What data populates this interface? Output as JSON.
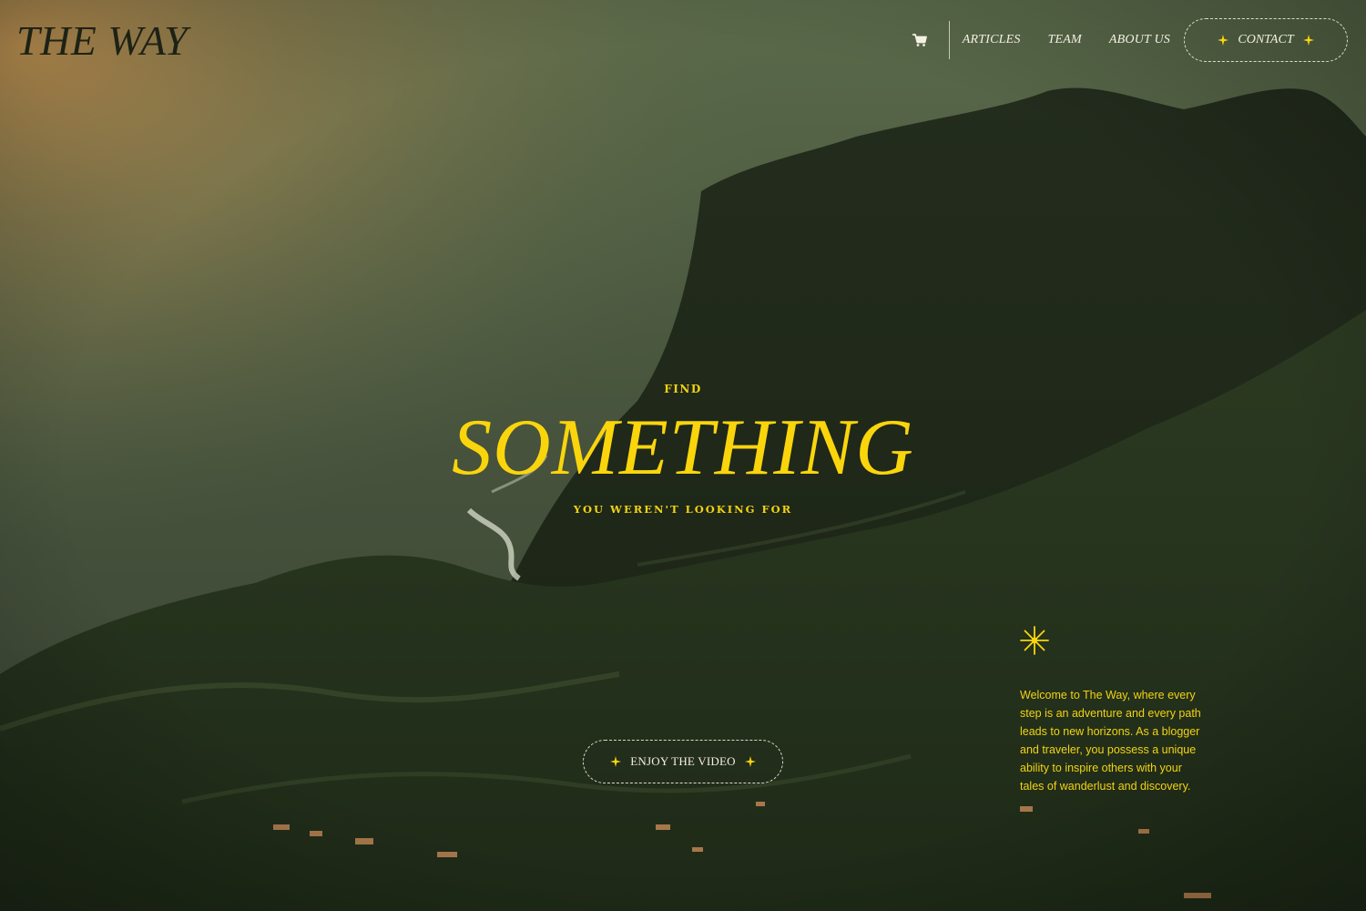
{
  "brand": {
    "logo": "THE WAY"
  },
  "nav": {
    "cart_icon": "cart-icon",
    "links": [
      "ARTICLES",
      "TEAM",
      "ABOUT US"
    ],
    "contact_label": "CONTACT"
  },
  "hero": {
    "kicker": "FIND",
    "headline": "SOMETHING",
    "subline": "YOU WEREN'T LOOKING FOR",
    "video_button_label": "ENJOY THE VIDEO"
  },
  "intro": {
    "icon": "sparkle-burst-icon",
    "text": "Welcome to The Way, where every step is an adventure and every path leads to new horizons. As a blogger and traveler, you possess a unique ability to inspire others with your tales of wanderlust and discovery."
  },
  "colors": {
    "accent_yellow": "#fbd50c",
    "nav_text": "#f3f0e4",
    "logo_dark": "#1d2216"
  }
}
